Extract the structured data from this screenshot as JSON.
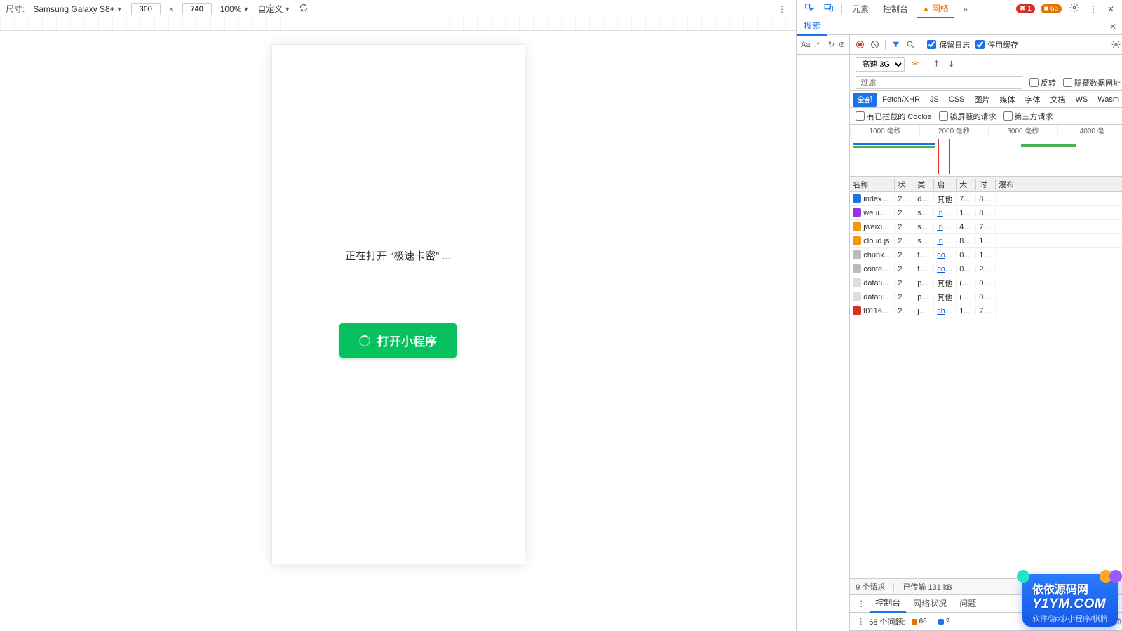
{
  "device_toolbar": {
    "size_label": "尺寸:",
    "device": "Samsung Galaxy S8+",
    "width": "360",
    "height": "740",
    "zoom": "100%",
    "custom": "自定义"
  },
  "phone": {
    "loading": "正在打开 “极速卡密” ...",
    "button": "打开小程序"
  },
  "devtools": {
    "tabs": {
      "elements": "元素",
      "console": "控制台",
      "network": "网络"
    },
    "errors": "1",
    "warns": "66",
    "search_tab": "搜索",
    "preserve_log": "保留日志",
    "disable_cache": "停用缓存",
    "throttle": "高速 3G",
    "filter_ph": "过滤",
    "invert": "反转",
    "hide_data": "隐藏数据网址",
    "types": [
      "全部",
      "Fetch/XHR",
      "JS",
      "CSS",
      "图片",
      "媒体",
      "字体",
      "文档",
      "WS",
      "Wasm"
    ],
    "cookies": {
      "blocked": "有已拦截的 Cookie",
      "hidden": "被屏蔽的请求",
      "third": "第三方请求"
    },
    "overview_ticks": [
      "1000 毫秒",
      "2000 毫秒",
      "3000 毫秒",
      "4000 毫"
    ],
    "headers": {
      "name": "名称",
      "status": "状",
      "type": "类",
      "initiator": "启",
      "size": "大",
      "time": "时",
      "waterfall": "瀑布"
    },
    "rows": [
      {
        "ic": "#1a73e8",
        "name": "index...",
        "st": "2...",
        "ty": "d...",
        "in": "其他",
        "sz": "7...",
        "tm": "8 ...",
        "wf": {
          "l": 0,
          "w": 7,
          "c": "#4caf50"
        }
      },
      {
        "ic": "#9334e6",
        "name": "weui...",
        "st": "2...",
        "ty": "s...",
        "in": "ind...",
        "sz": "1...",
        "tm": "81...",
        "wf": {
          "l": 0,
          "w": 10,
          "c": "#1a73e8",
          "g": 4
        }
      },
      {
        "ic": "#f29900",
        "name": "jweixi...",
        "st": "2...",
        "ty": "s...",
        "in": "ind...",
        "sz": "4...",
        "tm": "72...",
        "wf": {
          "l": 0,
          "w": 9,
          "c": "#1a73e8",
          "g": 3
        }
      },
      {
        "ic": "#f29900",
        "name": "cloud.js",
        "st": "2...",
        "ty": "s...",
        "in": "ind...",
        "sz": "8...",
        "tm": "1...",
        "wf": {
          "l": 0,
          "w": 16,
          "c": "#1a73e8",
          "g": 3
        }
      },
      {
        "ic": "#bbb",
        "name": "chunk...",
        "st": "2...",
        "ty": "f...",
        "in": "con...",
        "sz": "0...",
        "tm": "10...",
        "wf": {
          "l": 90,
          "w": 1,
          "c": "#1a73e8"
        }
      },
      {
        "ic": "#bbb",
        "name": "conte...",
        "st": "2...",
        "ty": "f...",
        "in": "con...",
        "sz": "0...",
        "tm": "26...",
        "wf": {
          "l": 90,
          "w": 1,
          "c": "#1a73e8"
        }
      },
      {
        "ic": "#ddd",
        "name": "data:i...",
        "st": "2...",
        "ty": "p...",
        "in": "其他",
        "sz": "(...",
        "tm": "0 ...",
        "wf": {
          "l": 90,
          "w": 1,
          "c": "#4caf50"
        }
      },
      {
        "ic": "#ddd",
        "name": "data:i...",
        "st": "2...",
        "ty": "p...",
        "in": "其他",
        "sz": "(...",
        "tm": "0 ...",
        "wf": {
          "l": 90,
          "w": 1,
          "c": "#4caf50"
        }
      },
      {
        "ic": "#d93025",
        "name": "t0116...",
        "st": "2...",
        "ty": "j...",
        "in": "chu...",
        "sz": "1...",
        "tm": "71...",
        "wf": {
          "l": 91,
          "w": 8,
          "c": "#4caf50",
          "r": 1
        }
      }
    ],
    "status": {
      "reqs": "9 个请求",
      "xfer": "已传输 131 kB"
    },
    "drawer": {
      "console": "控制台",
      "network": "网络状况",
      "issues": "问题"
    },
    "issues": {
      "label": "68 个问题:",
      "warn": "66",
      "info": "2"
    }
  },
  "watermark": {
    "cn": "依依源码网",
    "en": "Y1YM.COM",
    "sub": "软件/游戏/小程序/棋牌"
  }
}
